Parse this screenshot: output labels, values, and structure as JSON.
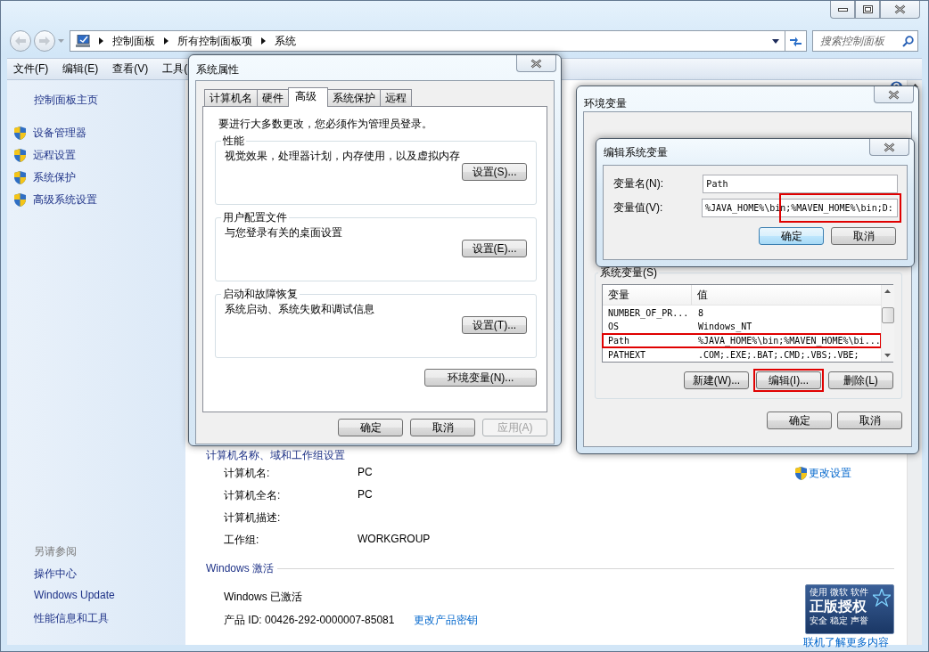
{
  "address_bar": {
    "breadcrumbs": [
      "控制面板",
      "所有控制面板项",
      "系统"
    ]
  },
  "search": {
    "placeholder": "搜索控制面板"
  },
  "menu_bar": [
    "文件(F)",
    "编辑(E)",
    "查看(V)",
    "工具("
  ],
  "sidebar": {
    "home": "控制面板主页",
    "items": [
      "设备管理器",
      "远程设置",
      "系统保护",
      "高级系统设置"
    ],
    "see_also": {
      "title": "另请参阅",
      "links": [
        "操作中心",
        "Windows Update",
        "性能信息和工具"
      ]
    }
  },
  "computer_section": {
    "title": "计算机名称、域和工作组设置",
    "change_link": "更改设置",
    "rows": [
      {
        "label": "计算机名:",
        "value": "PC"
      },
      {
        "label": "计算机全名:",
        "value": "PC"
      },
      {
        "label": "计算机描述:",
        "value": ""
      },
      {
        "label": "工作组:",
        "value": "WORKGROUP"
      }
    ]
  },
  "activation": {
    "title": "Windows 激活",
    "status": "Windows 已激活",
    "product_id": "产品 ID: 00426-292-0000007-85081",
    "change_key_link": "更改产品密钥",
    "badge": {
      "top": "使用 微软 软件",
      "main": "正版授权",
      "sub": "安全 稳定 声誉"
    },
    "learn_more": "联机了解更多内容"
  },
  "system_properties": {
    "title": "系统属性",
    "tabs": [
      {
        "label": "计算机名",
        "selected": false
      },
      {
        "label": "硬件",
        "selected": false
      },
      {
        "label": "高级",
        "selected": true
      },
      {
        "label": "系统保护",
        "selected": false
      },
      {
        "label": "远程",
        "selected": false
      }
    ],
    "note": "要进行大多数更改，您必须作为管理员登录。",
    "groups": [
      {
        "title": "性能",
        "description": "视觉效果，处理器计划，内存使用，以及虚拟内存",
        "button": "设置(S)..."
      },
      {
        "title": "用户配置文件",
        "description": "与您登录有关的桌面设置",
        "button": "设置(E)..."
      },
      {
        "title": "启动和故障恢复",
        "description": "系统启动、系统失败和调试信息",
        "button": "设置(T)..."
      }
    ],
    "env_button": "环境变量(N)...",
    "buttons": [
      {
        "label": "确定",
        "disabled": false
      },
      {
        "label": "取消",
        "disabled": false
      },
      {
        "label": "应用(A)",
        "disabled": true
      }
    ]
  },
  "environment_variables": {
    "title": "环境变量",
    "system_vars": {
      "title": "系统变量(S)",
      "columns": [
        "变量",
        "值"
      ],
      "rows": [
        {
          "name": "NUMBER_OF_PR...",
          "value": "8",
          "highlighted": false
        },
        {
          "name": "OS",
          "value": "Windows_NT",
          "highlighted": false
        },
        {
          "name": "Path",
          "value": "%JAVA_HOME%\\bin;%MAVEN_HOME%\\bi...",
          "highlighted": true
        },
        {
          "name": "PATHEXT",
          "value": ".COM;.EXE;.BAT;.CMD;.VBS;.VBE;",
          "highlighted": false
        }
      ]
    },
    "buttons": [
      {
        "label": "新建(W)...",
        "highlighted": false
      },
      {
        "label": "编辑(I)...",
        "highlighted": true
      },
      {
        "label": "删除(L)",
        "highlighted": false
      }
    ],
    "footer_buttons": [
      "确定",
      "取消"
    ]
  },
  "edit_variable": {
    "title": "编辑系统变量",
    "name_label": "变量名(N):",
    "name_value": "Path",
    "value_label": "变量值(V):",
    "value_value": "%JAVA_HOME%\\bin;%MAVEN_HOME%\\bin;D:",
    "value_highlighted": true,
    "buttons": [
      {
        "label": "确定",
        "default": true
      },
      {
        "label": "取消",
        "default": false
      }
    ]
  }
}
